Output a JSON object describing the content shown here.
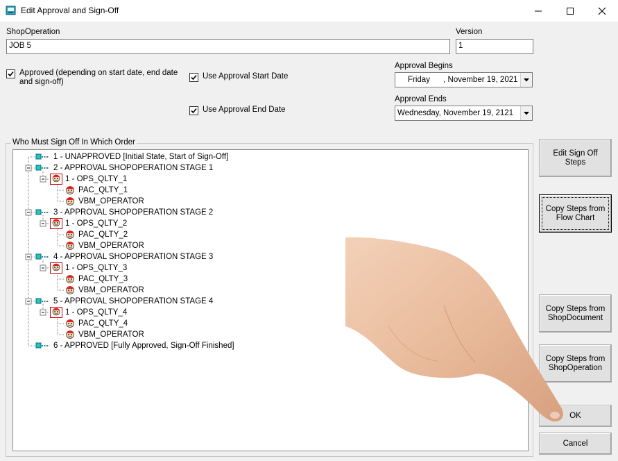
{
  "window": {
    "title": "Edit Approval and Sign-Off",
    "minimize_glyph": "—",
    "maximize_glyph": "☐",
    "close_glyph": "✕"
  },
  "form": {
    "shop_operation_label": "ShopOperation",
    "shop_operation_value": "JOB 5",
    "version_label": "Version",
    "version_value": "1",
    "approved_label": "Approved (depending on start date, end date and sign-off)",
    "approved_checked": true,
    "use_start_label": "Use Approval Start Date",
    "use_start_checked": true,
    "use_end_label": "Use Approval End Date",
    "use_end_checked": true,
    "begins_label": "Approval Begins",
    "begins_value": "Friday      , November 19, 2021",
    "ends_label": "Approval Ends",
    "ends_value": "Wednesday, November 19, 2121"
  },
  "tree": {
    "group_title": "Who Must Sign Off In Which Order",
    "rows": [
      {
        "text": "1 - UNAPPROVED [Initial State, Start of Sign-Off]",
        "level": 0,
        "kind": "stage",
        "expander": false
      },
      {
        "text": "2 - APPROVAL SHOPOPERATION STAGE 1",
        "level": 0,
        "kind": "stage",
        "expander": true
      },
      {
        "text": "1 - OPS_QLTY_1",
        "level": 1,
        "kind": "group",
        "expander": true
      },
      {
        "text": "PAC_QLTY_1",
        "level": 2,
        "kind": "user",
        "expander": false
      },
      {
        "text": "VBM_OPERATOR",
        "level": 2,
        "kind": "user",
        "expander": false
      },
      {
        "text": "3 - APPROVAL SHOPOPERATION STAGE 2",
        "level": 0,
        "kind": "stage",
        "expander": true
      },
      {
        "text": "1 - OPS_QLTY_2",
        "level": 1,
        "kind": "group",
        "expander": true
      },
      {
        "text": "PAC_QLTY_2",
        "level": 2,
        "kind": "user",
        "expander": false
      },
      {
        "text": "VBM_OPERATOR",
        "level": 2,
        "kind": "user",
        "expander": false
      },
      {
        "text": "4 - APPROVAL SHOPOPERATION STAGE 3",
        "level": 0,
        "kind": "stage",
        "expander": true
      },
      {
        "text": "1 - OPS_QLTY_3",
        "level": 1,
        "kind": "group",
        "expander": true
      },
      {
        "text": "PAC_QLTY_3",
        "level": 2,
        "kind": "user",
        "expander": false
      },
      {
        "text": "VBM_OPERATOR",
        "level": 2,
        "kind": "user",
        "expander": false
      },
      {
        "text": "5 - APPROVAL SHOPOPERATION STAGE 4",
        "level": 0,
        "kind": "stage",
        "expander": true
      },
      {
        "text": "1 - OPS_QLTY_4",
        "level": 1,
        "kind": "group",
        "expander": true
      },
      {
        "text": "PAC_QLTY_4",
        "level": 2,
        "kind": "user",
        "expander": false
      },
      {
        "text": "VBM_OPERATOR",
        "level": 2,
        "kind": "user",
        "expander": false
      },
      {
        "text": "6 - APPROVED [Fully Approved, Sign-Off Finished]",
        "level": 0,
        "kind": "stage",
        "expander": false
      }
    ]
  },
  "buttons": {
    "edit_steps": "Edit Sign Off Steps",
    "copy_flow": "Copy Steps from Flow Chart",
    "copy_doc": "Copy Steps from ShopDocument",
    "copy_op": "Copy Steps from ShopOperation",
    "ok": "OK",
    "cancel": "Cancel"
  }
}
